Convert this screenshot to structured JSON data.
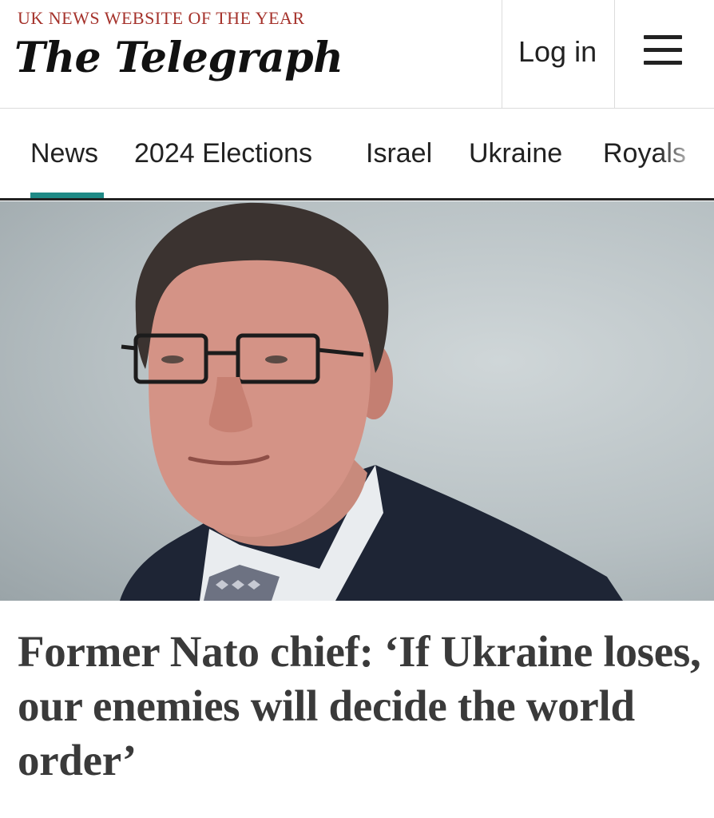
{
  "header": {
    "tagline": "UK NEWS WEBSITE OF THE YEAR",
    "masthead": "The Telegraph",
    "login_label": "Log in",
    "menu_icon": "hamburger-menu-icon"
  },
  "nav": {
    "items": [
      {
        "label": "News",
        "active": true
      },
      {
        "label": "2024 Elections"
      },
      {
        "label": "Israel"
      },
      {
        "label": "Ukraine"
      },
      {
        "label": "Royals"
      }
    ],
    "accent_color": "#1f8a86"
  },
  "article": {
    "headline": "Former Nato chief: ‘If Ukraine loses, our enemies will decide the world order’"
  },
  "colors": {
    "tagline": "#a5322b",
    "headline": "#3a3a3a"
  }
}
